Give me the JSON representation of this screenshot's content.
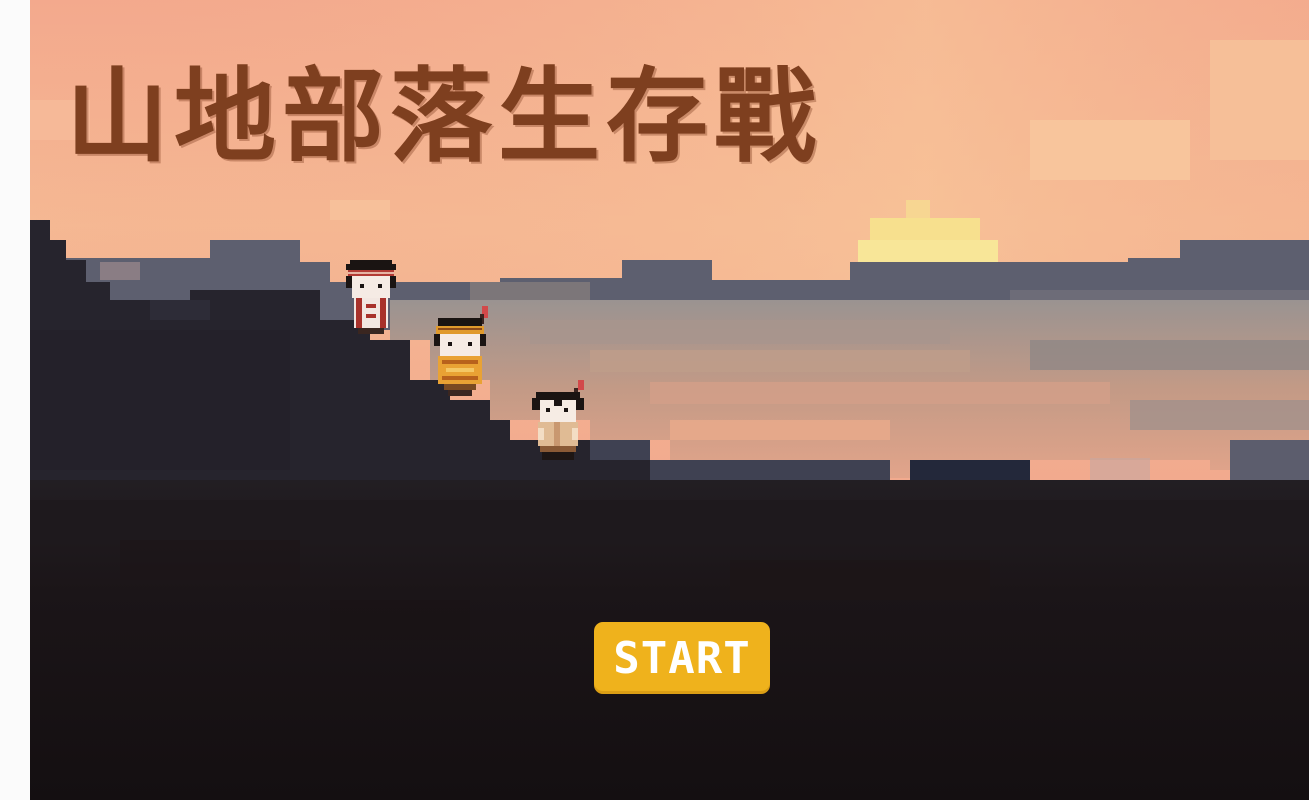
{
  "game": {
    "title": "山地部落生存戰",
    "start_label": "START"
  },
  "characters": [
    {
      "icon": "tribal-elder-character-icon",
      "outfit": "red-striped"
    },
    {
      "icon": "tribal-chief-character-icon",
      "outfit": "orange-feather"
    },
    {
      "icon": "tribal-villager-character-icon",
      "outfit": "tan-feather"
    }
  ],
  "colors": {
    "title": "#7e3f1f",
    "button": "#efb21c",
    "button_text": "#ffffff",
    "sky_top": "#f2a98d",
    "sun": "#f7e592",
    "ground": "#181214"
  }
}
